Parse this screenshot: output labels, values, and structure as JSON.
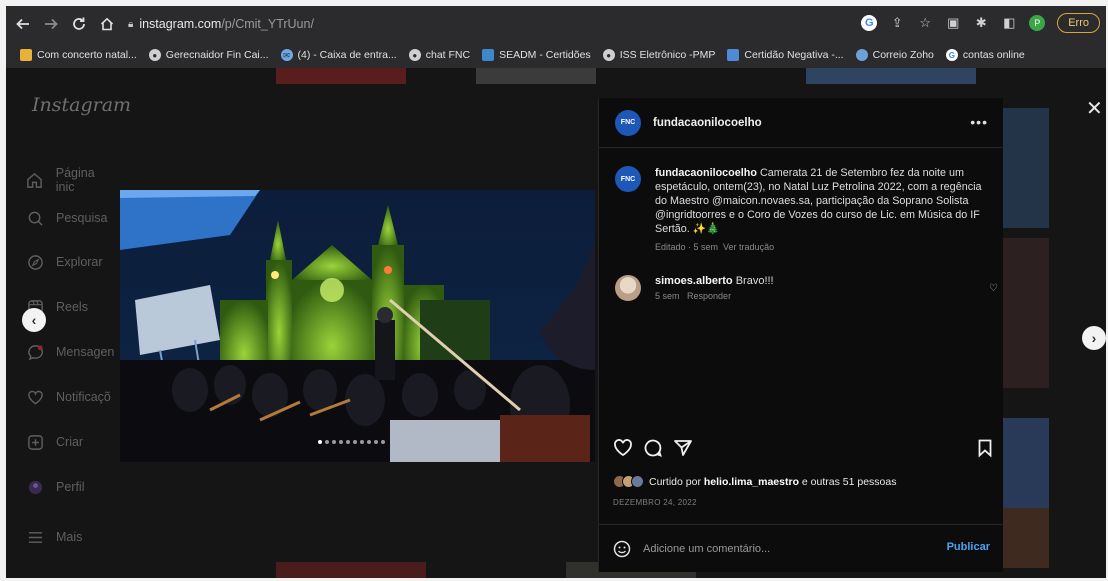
{
  "browser": {
    "url_host": "instagram.com",
    "url_path": "/p/Cmit_YTrUun/",
    "error_label": "Erro",
    "profile_initial": "P",
    "bookmarks": [
      {
        "label": "Com concerto natal...",
        "icon": "folder-icon"
      },
      {
        "label": "Gerecnaidor Fin Cai...",
        "icon": "globe-icon"
      },
      {
        "label": "(4) - Caixa de entra...",
        "icon": "mail-icon"
      },
      {
        "label": "chat FNC",
        "icon": "globe-icon"
      },
      {
        "label": "SEADM - Certidões",
        "icon": "seadm-icon"
      },
      {
        "label": "ISS Eletrônico -PMP",
        "icon": "globe-icon"
      },
      {
        "label": "Certidão Negativa -...",
        "icon": "document-icon"
      },
      {
        "label": "Correio Zoho",
        "icon": "zoho-icon"
      },
      {
        "label": "contas online",
        "icon": "google-icon"
      }
    ]
  },
  "instagram": {
    "logo": "Instagram",
    "nav": [
      {
        "label": "Página inic",
        "icon": "home-icon"
      },
      {
        "label": "Pesquisa",
        "icon": "search-icon"
      },
      {
        "label": "Explorar",
        "icon": "compass-icon"
      },
      {
        "label": "Reels",
        "icon": "reels-icon"
      },
      {
        "label": "Mensagen",
        "icon": "messenger-icon"
      },
      {
        "label": "Notificaçõ",
        "icon": "heart-icon"
      },
      {
        "label": "Criar",
        "icon": "plus-square-icon"
      },
      {
        "label": "Perfil",
        "icon": "profile-icon"
      },
      {
        "label": "Mais",
        "icon": "menu-icon"
      }
    ]
  },
  "post": {
    "username": "fundacaonilocoelho",
    "caption": "Camerata 21 de Setembro fez da noite um espetáculo, ontem(23), no Natal Luz Petrolina 2022, com a regência do Maestro @maicon.novaes.sa, participação da Soprano Solista @ingridtoorres e o Coro de Vozes do curso de Lic. em Música do IF Sertão. ✨🎄",
    "caption_meta": "Editado · 5 sem",
    "translate_label": "Ver tradução",
    "comment": {
      "username": "simoes.alberto",
      "text": "Bravo!!!",
      "time": "5 sem",
      "reply_label": "Responder"
    },
    "likes_prefix": "Curtido por ",
    "likes_user": "helio.lima_maestro",
    "likes_suffix": " e outras 51 pessoas",
    "date": "DEZEMBRO 24, 2022",
    "comment_placeholder": "Adicione um comentário...",
    "publish_label": "Publicar",
    "carousel": {
      "total": 10,
      "current": 1
    }
  }
}
